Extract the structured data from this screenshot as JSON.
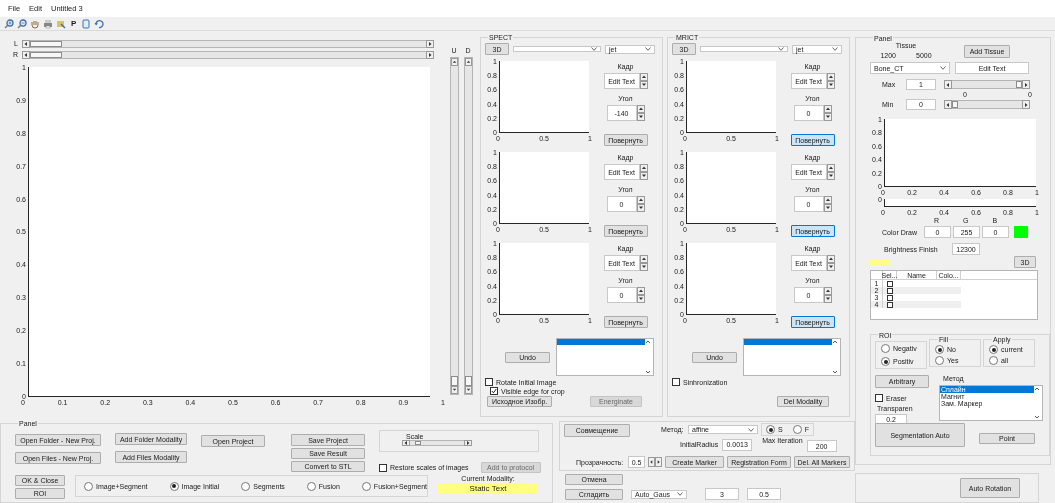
{
  "menu": [
    {
      "label": "File"
    },
    {
      "label": "Edit"
    },
    {
      "label": "Untitled 3"
    }
  ],
  "toolbar": {
    "p_button": "P"
  },
  "main_view": {
    "l_label": "L",
    "r_label": "R",
    "u_label": "U",
    "d_label": "D",
    "l_slider": {
      "level": 0
    },
    "r_slider": {
      "level": 0
    },
    "u_slider": {
      "level": 0
    },
    "d_slider": {
      "level": 0
    },
    "yticks": [
      "1",
      "0.9",
      "0.8",
      "0.7",
      "0.6",
      "0.5",
      "0.4",
      "0.3",
      "0.2",
      "0.1",
      "0"
    ],
    "xticks": [
      "0",
      "0.1",
      "0.2",
      "0.3",
      "0.4",
      "0.5",
      "0.6",
      "0.7",
      "0.8",
      "0.9",
      "1"
    ]
  },
  "modality_panels": [
    {
      "title": "SPECT",
      "button_3d": "3D",
      "colormap": "jet",
      "views": [
        {
          "yticks": [
            "1",
            "0.8",
            "0.6",
            "0.4",
            "0.2",
            "0"
          ],
          "xticks": [
            "0",
            "0.5",
            "1"
          ],
          "frame_label": "Кадр",
          "frame_value": "Edit Text",
          "angle_label": "Угол",
          "angle_value": "-140",
          "rotate_button": "Повернуть",
          "highlighted": false
        },
        {
          "yticks": [
            "1",
            "0.8",
            "0.6",
            "0.4",
            "0.2",
            "0"
          ],
          "xticks": [
            "0",
            "0.5",
            "1"
          ],
          "frame_label": "Кадр",
          "frame_value": "Edit Text",
          "angle_label": "Угол",
          "angle_value": "0",
          "rotate_button": "Повернуть",
          "highlighted": false
        },
        {
          "yticks": [
            "1",
            "0.8",
            "0.6",
            "0.4",
            "0.2",
            "0"
          ],
          "xticks": [
            "0",
            "0.5",
            "1"
          ],
          "frame_label": "Кадр",
          "frame_value": "Edit Text",
          "angle_label": "Угол",
          "angle_value": "0",
          "rotate_button": "Повернуть",
          "highlighted": false
        }
      ],
      "undo_button": "Undo",
      "listbox_highlight": true,
      "checkboxes": [
        {
          "label": "Rotate Initial Image",
          "checked": false
        },
        {
          "label": "Visible edge for crop",
          "checked": true
        }
      ],
      "buttons": [
        {
          "label": "Исходное Изобр.",
          "disabled": false
        },
        {
          "label": "Energinate",
          "disabled": true
        }
      ]
    },
    {
      "title": "MRICT",
      "button_3d": "3D",
      "colormap": "jet",
      "views": [
        {
          "yticks": [
            "1",
            "0.8",
            "0.6",
            "0.4",
            "0.2",
            "0"
          ],
          "xticks": [
            "0",
            "0.5",
            "1"
          ],
          "frame_label": "Кадр",
          "frame_value": "Edit Text",
          "angle_label": "Угол",
          "angle_value": "0",
          "rotate_button": "Повернуть",
          "highlighted": true
        },
        {
          "yticks": [
            "1",
            "0.8",
            "0.6",
            "0.4",
            "0.2",
            "0"
          ],
          "xticks": [
            "0",
            "0.5",
            "1"
          ],
          "frame_label": "Кадр",
          "frame_value": "Edit Text",
          "angle_label": "Угол",
          "angle_value": "0",
          "rotate_button": "Повернуть",
          "highlighted": true
        },
        {
          "yticks": [
            "1",
            "0.8",
            "0.6",
            "0.4",
            "0.2",
            "0"
          ],
          "xticks": [
            "0",
            "0.5",
            "1"
          ],
          "frame_label": "Кадр",
          "frame_value": "Edit Text",
          "angle_label": "Угол",
          "angle_value": "0",
          "rotate_button": "Повернуть",
          "highlighted": true
        }
      ],
      "undo_button": "Undo",
      "listbox_highlight": true,
      "checkboxes": [
        {
          "label": "Sinhronization",
          "checked": false
        }
      ],
      "buttons": [
        {
          "label": "Del Modality",
          "disabled": false
        }
      ]
    }
  ],
  "tissue_panel": {
    "title": "Panel",
    "tissue_label": "Tissue",
    "range_low": "1200",
    "range_high": "5000",
    "add_tissue_button": "Add Tissue",
    "tissue_dropdown": "Bone_CT",
    "edit_field": "Edit Text",
    "max": {
      "label": "Max",
      "value": "1",
      "level": 1,
      "ticks": [
        "0",
        "0"
      ]
    },
    "min": {
      "label": "Min",
      "value": "0",
      "level": 0
    },
    "histogram": {
      "yticks": [
        "1",
        "0.8",
        "0.6",
        "0.4",
        "0.2",
        "0"
      ],
      "xticks": [
        "0",
        "0.2",
        "0.4",
        "0.6",
        "0.8",
        "1"
      ]
    },
    "strip": {
      "yticks": [
        "0"
      ],
      "xticks": [
        "0",
        "0.2",
        "0.4",
        "0.6",
        "0.8",
        "1"
      ]
    },
    "rgb_labels": [
      "R",
      "G",
      "B"
    ],
    "color_draw": {
      "label": "Color Draw",
      "values": [
        "0",
        "255",
        "0"
      ],
      "color": "#00ff00"
    },
    "brightness": {
      "label": "Brightness Finish",
      "value": "12300"
    },
    "marker": {
      "color": "#ffff80"
    },
    "button_3d": "3D",
    "table": {
      "columns": [
        "Sel...",
        "Name",
        "Colo..."
      ],
      "rows": [
        {
          "index": "1",
          "checked": false
        },
        {
          "index": "2",
          "checked": false
        },
        {
          "index": "3",
          "checked": false
        },
        {
          "index": "4",
          "checked": false
        }
      ]
    },
    "roi": {
      "title": "ROI",
      "polarity": [
        {
          "label": "Negativ",
          "selected": false
        },
        {
          "label": "Positiv",
          "selected": true
        }
      ],
      "fill": {
        "title": "Fill",
        "options": [
          {
            "label": "No",
            "selected": true
          },
          {
            "label": "Yes",
            "selected": false
          }
        ]
      },
      "apply": {
        "title": "Apply",
        "options": [
          {
            "label": "current",
            "selected": true
          },
          {
            "label": "all",
            "selected": false
          }
        ]
      },
      "arbitrary_button": "Arbitrary",
      "method_label": "Метод",
      "methods": [
        {
          "label": "Сплайн",
          "selected": true
        },
        {
          "label": "Магнит",
          "selected": false
        },
        {
          "label": "Зам. Маркер",
          "selected": false
        }
      ],
      "eraser": {
        "label": "Eraser",
        "checked": false
      },
      "transparency_label": "Transparen",
      "transparency_value": "0.2",
      "segmentation_button": "Segmentation Auto",
      "point_button": "Point"
    }
  },
  "auto_rotation_button": "Auto Rotation",
  "project_panel": {
    "title": "Panel",
    "open_folder": "Open Folder - New Proj.",
    "add_folder": "Add Folder Modality",
    "open_project": "Open Project",
    "save_project": "Save Project",
    "save_result": "Save Result",
    "convert": "Convert to STL",
    "open_files": "Open Files - New Proj.",
    "add_files": "Add Files Modality",
    "scale": {
      "title": "Scale",
      "level": 0.1
    },
    "restore": {
      "label": "Restore scales of images",
      "checked": false
    },
    "add_protocol": {
      "label": "Add to protocol",
      "disabled": true
    },
    "ok_close": "OK & Close",
    "roi_button": "ROI",
    "display_modes": [
      {
        "label": "Image+Segment",
        "selected": false
      },
      {
        "label": "Image Initial",
        "selected": true
      },
      {
        "label": "Segments",
        "selected": false
      },
      {
        "label": "Fusion",
        "selected": false
      },
      {
        "label": "Fusion+Segment",
        "selected": false
      }
    ],
    "current_modality_label": "Current Modality:",
    "current_modality": "Static Text"
  },
  "registration_panel": {
    "align_button": "Совмещение",
    "method_label": "Метод:",
    "method": "affine",
    "mode": [
      {
        "label": "S",
        "selected": true
      },
      {
        "label": "F",
        "selected": false
      }
    ],
    "initial_radius_label": "InitialRadius",
    "initial_radius": "0.0013",
    "max_iteration_label": "Max Iteration",
    "max_iteration": "200",
    "transparency_label": "Прозрачность:",
    "transparency": "0.5",
    "create_marker": "Create Marker",
    "registration_form": "Registration Form",
    "del_markers": "Del. All Markers",
    "cancel": "Отмена",
    "smooth": "Сгладить",
    "filter": "Auto_Gaus",
    "filter_size": "3",
    "filter_sigma": "0.5"
  }
}
